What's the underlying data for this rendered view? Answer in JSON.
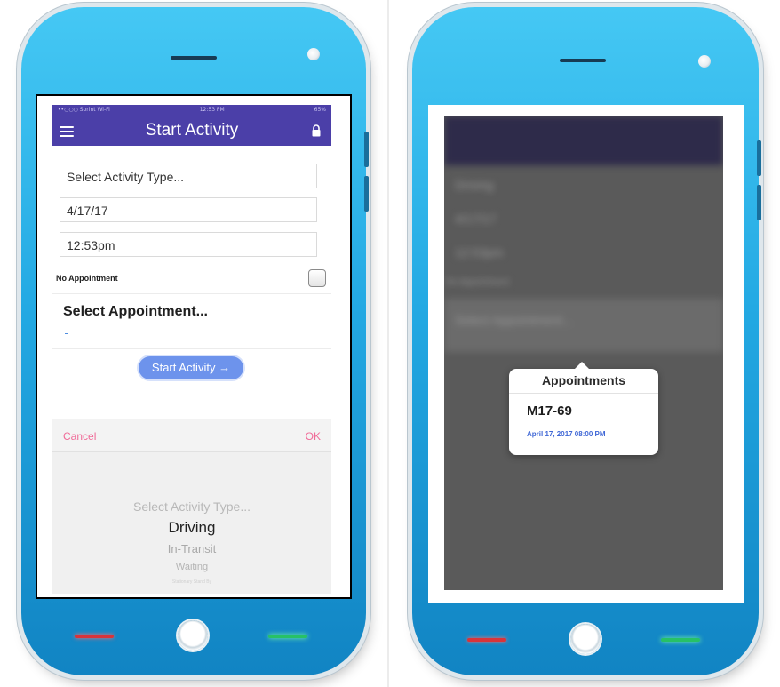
{
  "left_screen": {
    "status": {
      "carrier": "••○○○ Sprint Wi-Fi",
      "time": "12:53 PM",
      "battery": "65%"
    },
    "title": "Start Activity",
    "fields": {
      "activity_type": "Select Activity Type...",
      "date": "4/17/17",
      "time": "12:53pm"
    },
    "no_appointment_label": "No Appointment",
    "select_appointment_label": "Select Appointment...",
    "start_button_label": "Start Activity",
    "start_button_arrow": "→",
    "picker": {
      "cancel": "Cancel",
      "ok": "OK",
      "options": [
        "Select Activity Type...",
        "Driving",
        "In-Transit",
        "Waiting",
        "Stationary Stand By"
      ],
      "selected_index": 1
    }
  },
  "right_screen": {
    "background_rows": [
      "Driving",
      "4/17/17",
      "12:53pm",
      "No Appointment",
      "Select Appointment..."
    ],
    "popover": {
      "title": "Appointments",
      "item": "M17-69",
      "item_date": "April 17, 2017 08:00 PM"
    }
  },
  "icons": [
    "hamburger-icon",
    "lock-icon",
    "arrow-right-icon"
  ],
  "colors": {
    "nav_bar": "#4b3fa8",
    "start_button": "#6d93ec",
    "picker_action": "#f06b98",
    "phone_body": "#23a9e3"
  }
}
